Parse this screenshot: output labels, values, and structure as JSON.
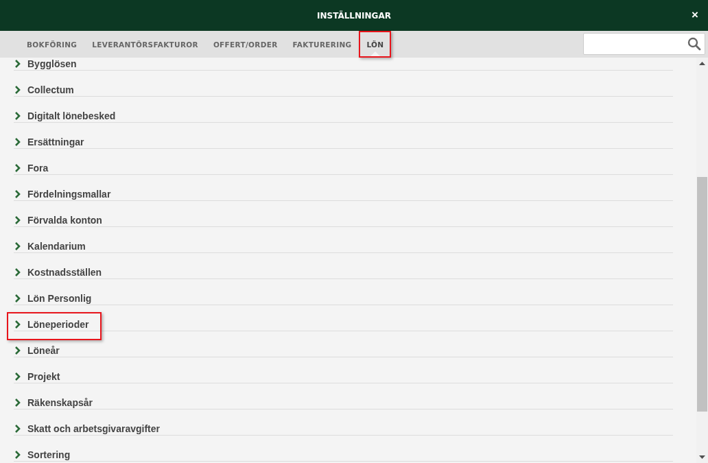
{
  "window": {
    "title": "INSTÄLLNINGAR",
    "close": "×"
  },
  "tabs": [
    {
      "label": "BOKFÖRING",
      "selected": false,
      "highlighted": false
    },
    {
      "label": "LEVERANTÖRSFAKTUROR",
      "selected": false,
      "highlighted": false
    },
    {
      "label": "OFFERT/ORDER",
      "selected": false,
      "highlighted": false
    },
    {
      "label": "FAKTURERING",
      "selected": false,
      "highlighted": false
    },
    {
      "label": "LÖN",
      "selected": true,
      "highlighted": true
    }
  ],
  "items": [
    {
      "label": "Bygglösen",
      "highlighted": false
    },
    {
      "label": "Collectum",
      "highlighted": false
    },
    {
      "label": "Digitalt lönebesked",
      "highlighted": false
    },
    {
      "label": "Ersättningar",
      "highlighted": false
    },
    {
      "label": "Fora",
      "highlighted": false
    },
    {
      "label": "Fördelningsmallar",
      "highlighted": false
    },
    {
      "label": "Förvalda konton",
      "highlighted": false
    },
    {
      "label": "Kalendarium",
      "highlighted": false
    },
    {
      "label": "Kostnadsställen",
      "highlighted": false
    },
    {
      "label": "Lön Personlig",
      "highlighted": false
    },
    {
      "label": "Löneperioder",
      "highlighted": true
    },
    {
      "label": "Löneår",
      "highlighted": false
    },
    {
      "label": "Projekt",
      "highlighted": false
    },
    {
      "label": "Räkenskapsår",
      "highlighted": false
    },
    {
      "label": "Skatt och arbetsgivaravgifter",
      "highlighted": false
    },
    {
      "label": "Sortering",
      "highlighted": false
    }
  ]
}
